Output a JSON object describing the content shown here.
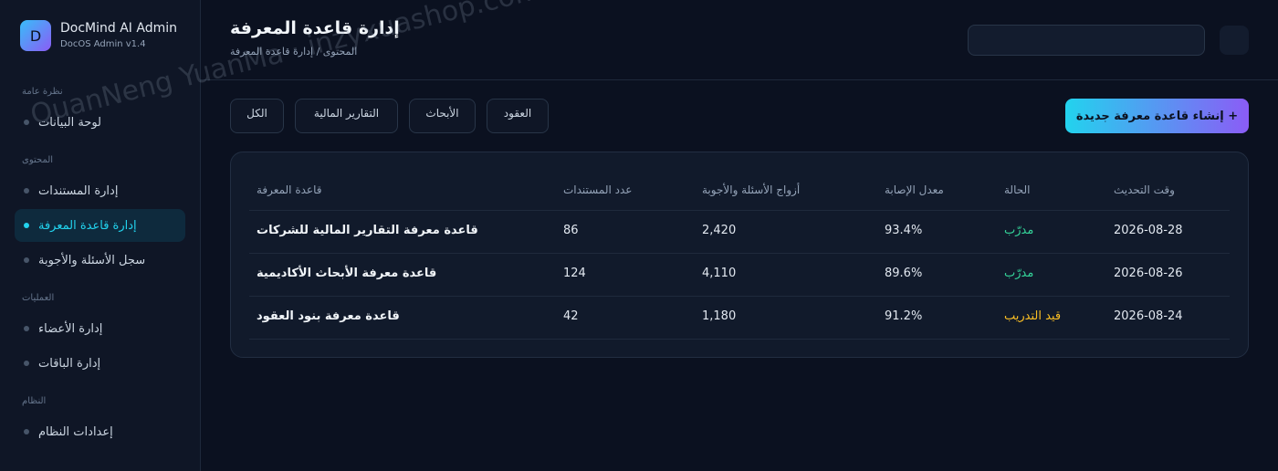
{
  "brand": {
    "logo_letter": "D",
    "name": "DocMind AI Admin",
    "subtitle": "DocOS Admin v1.4"
  },
  "sidebar": {
    "sections": [
      {
        "title": "نظرة عامة",
        "items": [
          {
            "label": "لوحة البيانات",
            "active": false
          }
        ]
      },
      {
        "title": "المحتوى",
        "items": [
          {
            "label": "إدارة المستندات",
            "active": false
          },
          {
            "label": "إدارة قاعدة المعرفة",
            "active": true
          },
          {
            "label": "سجل الأسئلة والأجوبة",
            "active": false
          }
        ]
      },
      {
        "title": "العمليات",
        "items": [
          {
            "label": "إدارة الأعضاء",
            "active": false
          },
          {
            "label": "إدارة الباقات",
            "active": false
          }
        ]
      },
      {
        "title": "النظام",
        "items": [
          {
            "label": "إعدادات النظام",
            "active": false
          }
        ]
      }
    ]
  },
  "header": {
    "title": "إدارة قاعدة المعرفة",
    "breadcrumb": "المحتوى / إدارة قاعدة المعرفة"
  },
  "filters": [
    "الكل",
    "التقارير المالية",
    "الأبحاث",
    "العقود"
  ],
  "create_button": "إنشاء قاعدة معرفة جديدة +",
  "table": {
    "headers": [
      "قاعدة المعرفة",
      "عدد المستندات",
      "أزواج الأسئلة والأجوبة",
      "معدل الإصابة",
      "الحالة",
      "وقت التحديث"
    ],
    "rows": [
      {
        "name": "قاعدة معرفة التقارير المالية للشركات",
        "docs": "86",
        "qa": "2,420",
        "hit": "93.4%",
        "status": "مدرّب",
        "updated": "2026-08-28"
      },
      {
        "name": "قاعدة معرفة الأبحاث الأكاديمية",
        "docs": "124",
        "qa": "4,110",
        "hit": "89.6%",
        "status": "مدرّب",
        "updated": "2026-08-26"
      },
      {
        "name": "قاعدة معرفة بنود العقود",
        "docs": "42",
        "qa": "1,180",
        "hit": "91.2%",
        "status": "قيد التدريب",
        "updated": "2026-08-24"
      }
    ]
  },
  "watermark": "QuanNeng YuanMa · inzyxuashop.com",
  "colors": {
    "accent": "#22d3ee",
    "accent2": "#8b5cf6",
    "trained": "#34d399",
    "training": "#fbbf24"
  }
}
